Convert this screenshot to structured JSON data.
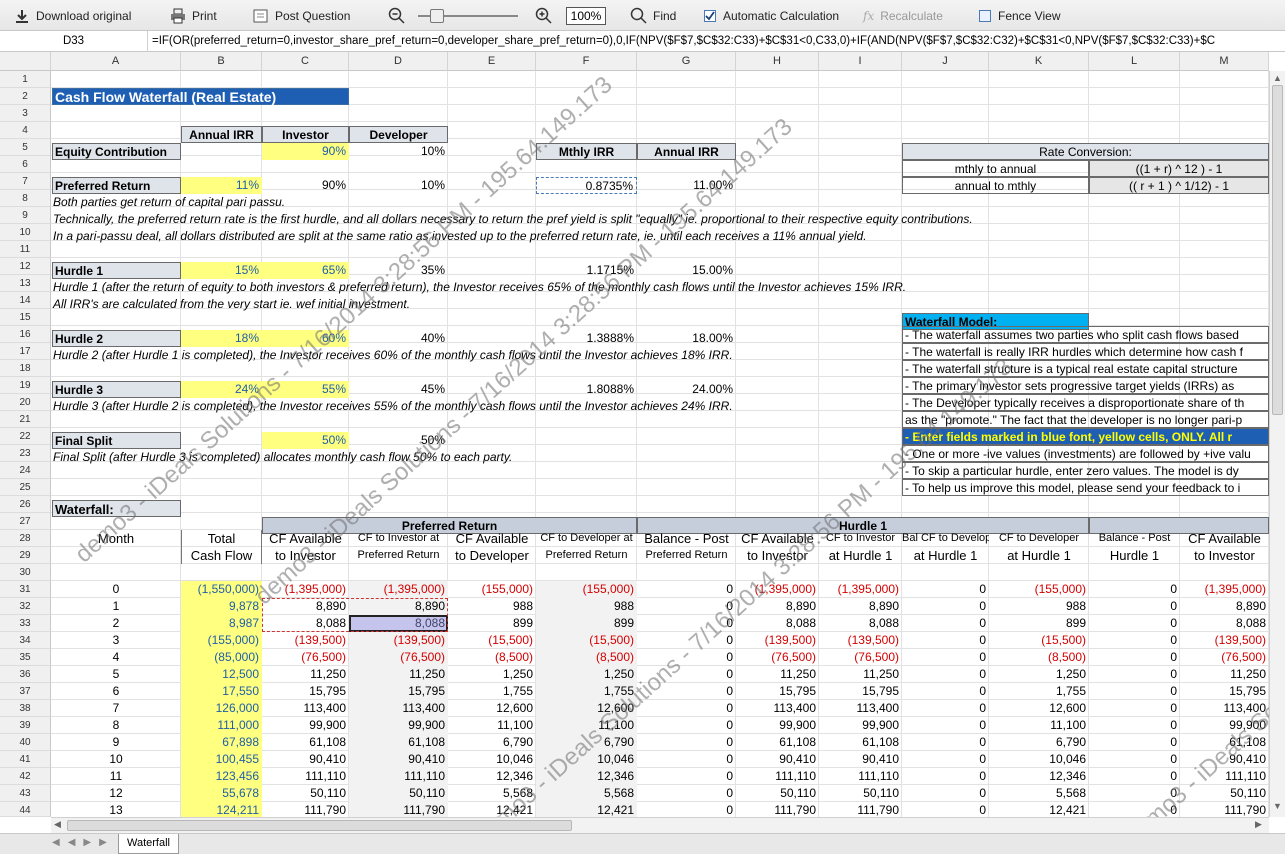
{
  "toolbar": {
    "download": "Download original",
    "print": "Print",
    "post_question": "Post Question",
    "zoom": "100%",
    "find": "Find",
    "auto_calc": "Automatic Calculation",
    "recalc": "Recalculate",
    "fence": "Fence View"
  },
  "formula_bar": {
    "cell_ref": "D33",
    "formula": "=IF(OR(preferred_return=0,investor_share_pref_return=0,developer_share_pref_return=0),0,IF(NPV($F$7,$C$32:C33)+$C$31<0,C33,0)+IF(AND(NPV($F$7,$C$32:C32)+$C$31<0,NPV($F$7,$C$32:C33)+$C"
  },
  "columns": [
    "A",
    "B",
    "C",
    "D",
    "E",
    "F",
    "G",
    "H",
    "I",
    "J",
    "K",
    "L",
    "M"
  ],
  "rows": [
    "1",
    "2",
    "3",
    "4",
    "5",
    "6",
    "7",
    "8",
    "9",
    "10",
    "11",
    "12",
    "13",
    "14",
    "15",
    "16",
    "17",
    "18",
    "19",
    "20",
    "21",
    "22",
    "23",
    "24",
    "25",
    "26",
    "27",
    "28",
    "29",
    "30",
    "31",
    "32",
    "33",
    "34",
    "35",
    "36",
    "37",
    "38",
    "39",
    "40",
    "41",
    "42",
    "43",
    "44"
  ],
  "sheet": {
    "title": "Cash Flow Waterfall (Real Estate)",
    "hdr_annual_irr": "Annual IRR",
    "hdr_investor": "Investor",
    "hdr_developer": "Developer",
    "equity_label": "Equity Contribution",
    "equity_inv": "90%",
    "equity_dev": "10%",
    "hdr_mthly_irr": "Mthly IRR",
    "hdr_annual_irr2": "Annual IRR",
    "rate_conv": "Rate Conversion:",
    "m2a_label": "mthly to annual",
    "m2a_formula": "((1 + r) ^ 12 ) - 1",
    "a2m_label": "annual to mthly",
    "a2m_formula": "(( r + 1 ) ^ 1/12) - 1",
    "pref_label": "Preferred Return",
    "pref_irr": "11%",
    "pref_inv": "90%",
    "pref_dev": "10%",
    "pref_mthly": "0.8735%",
    "pref_annual": "11.00%",
    "note8": "Both parties get return of capital pari passu.",
    "note9": "Technically, the preferred return rate is the first hurdle, and all dollars necessary to return the pref yield is split \"equally\" ie. proportional to their respective equity contributions.",
    "note10": "In a pari-passu deal, all dollars distributed are split at the same ratio as invested up to the preferred return rate, ie. until each receives a 11% annual yield.",
    "h1_label": "Hurdle 1",
    "h1_irr": "15%",
    "h1_inv": "65%",
    "h1_dev": "35%",
    "h1_mthly": "1.1715%",
    "h1_annual": "15.00%",
    "note13": "Hurdle 1 (after the return of equity to both investors & preferred return), the Investor receives 65% of the monthly cash flows until the Investor achieves 15% IRR.",
    "note14": "All IRR's are calculated from the very start ie. wef initial investment.",
    "wf_model": "Waterfall Model:",
    "h2_label": "Hurdle 2",
    "h2_irr": "18%",
    "h2_inv": "60%",
    "h2_dev": "40%",
    "h2_mthly": "1.3888%",
    "h2_annual": "18.00%",
    "note17": "Hurdle 2 (after Hurdle 1 is completed), the Investor receives 60% of the monthly cash flows until the Investor achieves 18% IRR.",
    "h3_label": "Hurdle 3",
    "h3_irr": "24%",
    "h3_inv": "55%",
    "h3_dev": "45%",
    "h3_mthly": "1.8088%",
    "h3_annual": "24.00%",
    "note20": "Hurdle 3 (after Hurdle 2 is completed), the Investor receives 55% of the monthly cash flows until the Investor achieves 24% IRR.",
    "fs_label": "Final Split",
    "fs_inv": "50%",
    "fs_dev": "50%",
    "note23": "Final Split (after Hurdle 3 is completed) allocates monthly cash flow 50% to each party.",
    "wf_label": "Waterfall:",
    "model_notes": [
      "- The waterfall assumes two parties who split cash flows based",
      "- The waterfall is really IRR hurdles which determine how cash f",
      "- The waterfall structure is a typical real estate capital structure",
      "- The primary investor sets progressive target yields (IRRs) as",
      "- The Developer typically receives a disproportionate share of th",
      "as the \"promote.\" The fact that the developer is no longer pari-p",
      "- Enter fields marked in blue font, yellow cells, ONLY. All r",
      "- One or more -ive values (investments) are followed by +ive valu",
      "- To skip a particular hurdle, enter zero values. The model is dy",
      "- To help us improve this model, please send your feedback to i"
    ],
    "sec_pref": "Preferred Return",
    "sec_h1": "Hurdle 1",
    "col_hdrs": [
      [
        "Month",
        ""
      ],
      [
        "Total",
        "Cash Flow"
      ],
      [
        "CF Available",
        "to Investor"
      ],
      [
        "CF to Investor at",
        "Preferred Return"
      ],
      [
        "CF Available",
        "to Developer"
      ],
      [
        "CF to Developer at",
        "Preferred Return"
      ],
      [
        "Balance - Post",
        "Preferred Return"
      ],
      [
        "CF Available",
        "to Investor"
      ],
      [
        "CF to Investor",
        "at Hurdle 1"
      ],
      [
        "Bal CF to Develop",
        "at Hurdle 1"
      ],
      [
        "CF to Developer",
        "at Hurdle 1"
      ],
      [
        "Balance - Post",
        "Hurdle 1"
      ],
      [
        "CF Available",
        "to Investor"
      ]
    ]
  },
  "table_rows": [
    [
      "0",
      "(1,550,000)",
      "(1,395,000)",
      "(1,395,000)",
      "(155,000)",
      "(155,000)",
      "0",
      "(1,395,000)",
      "(1,395,000)",
      "0",
      "(155,000)",
      "0",
      "(1,395,000)"
    ],
    [
      "1",
      "9,878",
      "8,890",
      "8,890",
      "988",
      "988",
      "0",
      "8,890",
      "8,890",
      "0",
      "988",
      "0",
      "8,890"
    ],
    [
      "2",
      "8,987",
      "8,088",
      "8,088",
      "899",
      "899",
      "0",
      "8,088",
      "8,088",
      "0",
      "899",
      "0",
      "8,088"
    ],
    [
      "3",
      "(155,000)",
      "(139,500)",
      "(139,500)",
      "(15,500)",
      "(15,500)",
      "0",
      "(139,500)",
      "(139,500)",
      "0",
      "(15,500)",
      "0",
      "(139,500)"
    ],
    [
      "4",
      "(85,000)",
      "(76,500)",
      "(76,500)",
      "(8,500)",
      "(8,500)",
      "0",
      "(76,500)",
      "(76,500)",
      "0",
      "(8,500)",
      "0",
      "(76,500)"
    ],
    [
      "5",
      "12,500",
      "11,250",
      "11,250",
      "1,250",
      "1,250",
      "0",
      "11,250",
      "11,250",
      "0",
      "1,250",
      "0",
      "11,250"
    ],
    [
      "6",
      "17,550",
      "15,795",
      "15,795",
      "1,755",
      "1,755",
      "0",
      "15,795",
      "15,795",
      "0",
      "1,755",
      "0",
      "15,795"
    ],
    [
      "7",
      "126,000",
      "113,400",
      "113,400",
      "12,600",
      "12,600",
      "0",
      "113,400",
      "113,400",
      "0",
      "12,600",
      "0",
      "113,400"
    ],
    [
      "8",
      "111,000",
      "99,900",
      "99,900",
      "11,100",
      "11,100",
      "0",
      "99,900",
      "99,900",
      "0",
      "11,100",
      "0",
      "99,900"
    ],
    [
      "9",
      "67,898",
      "61,108",
      "61,108",
      "6,790",
      "6,790",
      "0",
      "61,108",
      "61,108",
      "0",
      "6,790",
      "0",
      "61,108"
    ],
    [
      "10",
      "100,455",
      "90,410",
      "90,410",
      "10,046",
      "10,046",
      "0",
      "90,410",
      "90,410",
      "0",
      "10,046",
      "0",
      "90,410"
    ],
    [
      "11",
      "123,456",
      "111,110",
      "111,110",
      "12,346",
      "12,346",
      "0",
      "111,110",
      "111,110",
      "0",
      "12,346",
      "0",
      "111,110"
    ],
    [
      "12",
      "55,678",
      "50,110",
      "50,110",
      "5,568",
      "5,568",
      "0",
      "50,110",
      "50,110",
      "0",
      "5,568",
      "0",
      "50,110"
    ],
    [
      "13",
      "124,211",
      "111,790",
      "111,790",
      "12,421",
      "12,421",
      "0",
      "111,790",
      "111,790",
      "0",
      "12,421",
      "0",
      "111,790"
    ]
  ],
  "watermarks": [
    "demo3 - iDeals Solutions - 7/16/2014 3:28:56 PM - 195.64.149.173",
    "demo3 - iDeals Solutions - 7/16/2014 3:28:56 PM - 195.64.149.173",
    "demo3 - iDeals Solutions - 7/16/2014 3:28:56 PM - 195.64.149.173",
    "demo3 - iDeals Solutions - 7/16/2014 3:28:56 PM - 195.64.149.173"
  ],
  "sheet_tab": "Waterfall"
}
